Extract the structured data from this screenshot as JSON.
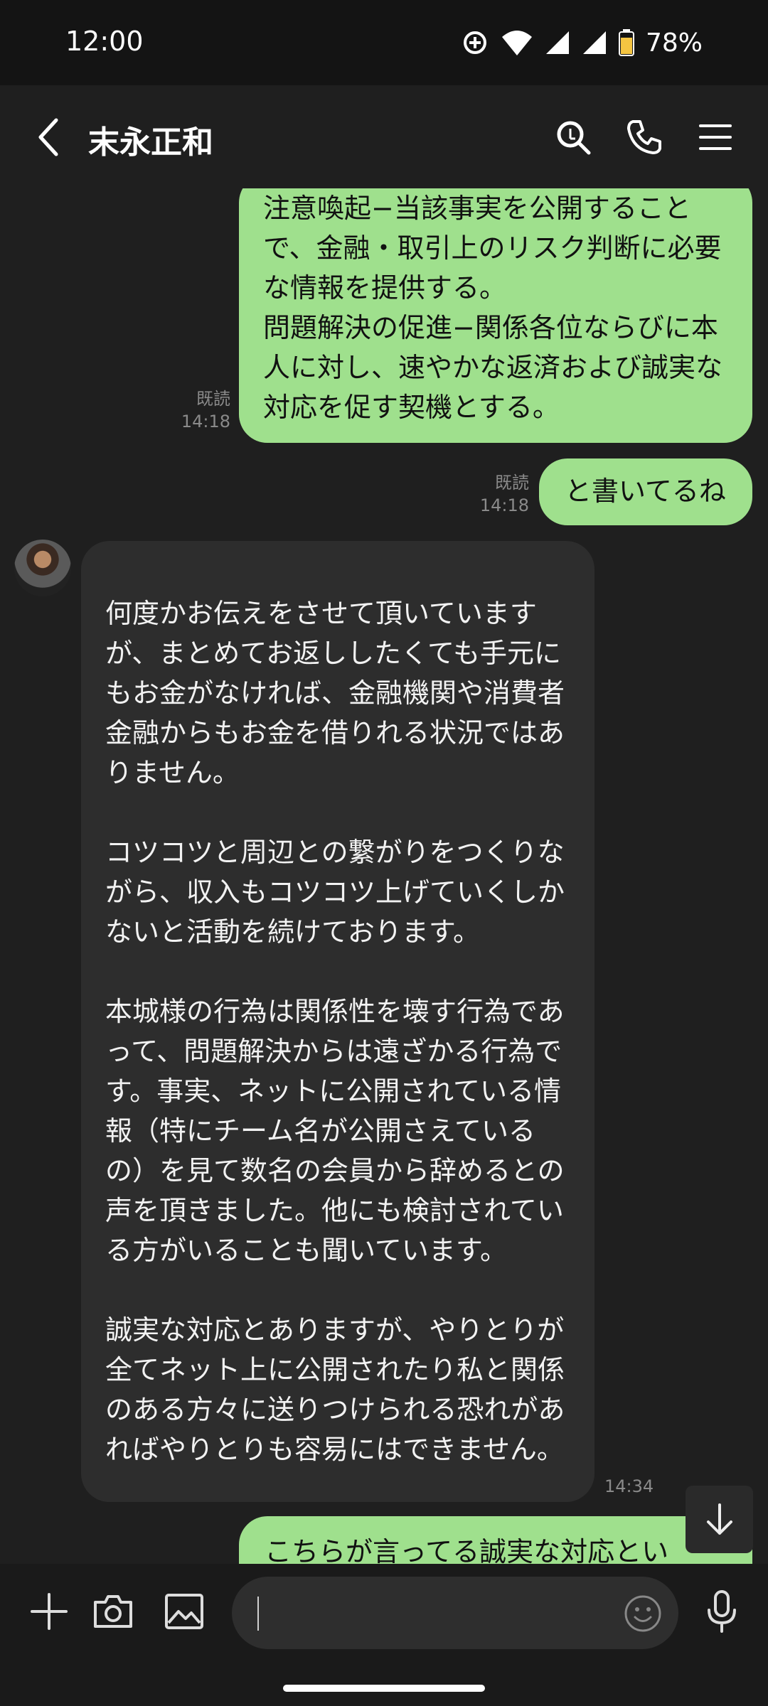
{
  "status_bar": {
    "time": "12:00",
    "battery": "78%"
  },
  "header": {
    "title": "末永正和"
  },
  "messages": {
    "m1": {
      "text": "注意喚起−当該事実を公開することで、金融・取引上のリスク判断に必要な情報を提供する。\n問題解決の促進−関係各位ならびに本人に対し、速やかな返済および誠実な対応を促す契機とする。",
      "read": "既読",
      "time": "14:18"
    },
    "m2": {
      "text": "と書いてるね",
      "read": "既読",
      "time": "14:18"
    },
    "m3": {
      "text": "何度かお伝えをさせて頂いていますが、まとめてお返ししたくても手元にもお金がなければ、金融機関や消費者金融からもお金を借りれる状況ではありません。\n\nコツコツと周辺との繋がりをつくりながら、収入もコツコツ上げていくしかないと活動を続けております。\n\n本城様の行為は関係性を壊す行為であって、問題解決からは遠ざかる行為です。事実、ネットに公開されている情報（特にチーム名が公開さえているの）を見て数名の会員から辞めるとの声を頂きました。他にも検討されている方がいることも聞いています。\n\n誠実な対応とありますが、やりとりが全てネット上に公開されたり私と関係のある方々に送りつけられる恐れがあればやりとりも容易にはできません。",
      "time": "14:34"
    },
    "m4": {
      "text": "こちらが言ってる誠実な対応とい"
    }
  },
  "icons": {
    "back": "chevron-left-icon",
    "search": "search-icon",
    "call": "phone-icon",
    "menu": "menu-icon",
    "plus": "plus-icon",
    "camera": "camera-icon",
    "image": "image-icon",
    "emoji": "emoji-icon",
    "mic": "microphone-icon",
    "scroll": "arrow-down-icon"
  },
  "colors": {
    "outgoing_bubble": "#9fe08d",
    "incoming_bubble": "#2d2d2d",
    "background": "#1f1f1f"
  }
}
